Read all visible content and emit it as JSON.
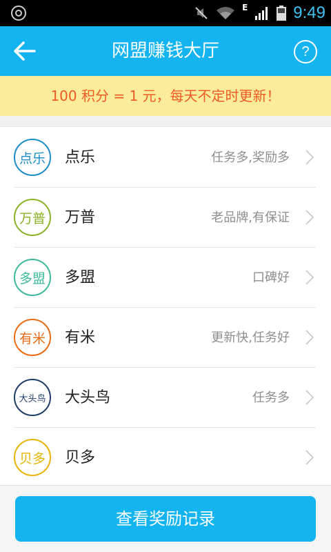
{
  "status_bar": {
    "network_type": "E",
    "time": "9:49",
    "icons": [
      "settings-ring-icon",
      "mute-icon",
      "wifi-icon",
      "signal-icon",
      "battery-icon"
    ]
  },
  "header": {
    "title": "网盟赚钱大厅",
    "help_label": "?",
    "back_icon": "back-arrow-icon"
  },
  "notice": {
    "text": "100 积分 = 1 元，每天不定时更新！"
  },
  "list": {
    "items": [
      {
        "logo_text": "点乐",
        "name": "点乐",
        "description": "任务多,奖励多",
        "color": "#1c8cc9"
      },
      {
        "logo_text": "万普",
        "name": "万普",
        "description": "老品牌,有保证",
        "color": "#8ab227"
      },
      {
        "logo_text": "多盟",
        "name": "多盟",
        "description": "口碑好",
        "color": "#3cb99a"
      },
      {
        "logo_text": "有米",
        "name": "有米",
        "description": "更新快,任务好",
        "color": "#ea6a12"
      },
      {
        "logo_text": "大头鸟",
        "name": "大头鸟",
        "description": "任务多",
        "color": "#1e3c6a"
      },
      {
        "logo_text": "贝多",
        "name": "贝多",
        "description": "",
        "color": "#e8b400"
      }
    ]
  },
  "footer": {
    "records_button_label": "查看奖励记录"
  },
  "colors": {
    "primary": "#13b4ef",
    "notice_bg": "#fbec9b",
    "notice_text": "#ef5a24"
  }
}
